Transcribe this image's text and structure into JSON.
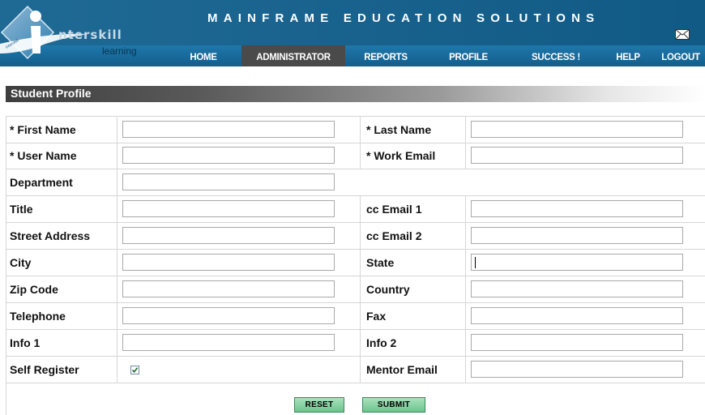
{
  "brand": {
    "name": "nterskill",
    "sub": "learning",
    "badge": "interskill",
    "tagline": "MAINFRAME EDUCATION SOLUTIONS"
  },
  "colors": {
    "header_blue": "#1b6590",
    "nav_blue": "#1f78aa",
    "active_tab": "#4a4a4a",
    "button_green": "#6cc48d"
  },
  "nav": {
    "items": [
      "HOME",
      "ADMINISTRATOR",
      "REPORTS",
      "PROFILE",
      "SUCCESS !",
      "HELP",
      "LOGOUT"
    ],
    "active": "ADMINISTRATOR",
    "mail_icon": "envelope-icon"
  },
  "section": {
    "title": "Student Profile"
  },
  "form": {
    "first_name": {
      "label": "* First Name",
      "value": ""
    },
    "last_name": {
      "label": "* Last Name",
      "value": ""
    },
    "user_name": {
      "label": "* User Name",
      "value": ""
    },
    "work_email": {
      "label": "* Work Email",
      "value": ""
    },
    "department": {
      "label": "Department",
      "value": ""
    },
    "title": {
      "label": "Title",
      "value": ""
    },
    "cc_email_1": {
      "label": "cc Email 1",
      "value": ""
    },
    "street_address": {
      "label": "Street Address",
      "value": ""
    },
    "cc_email_2": {
      "label": "cc Email 2",
      "value": ""
    },
    "city": {
      "label": "City",
      "value": ""
    },
    "state": {
      "label": "State",
      "value": ""
    },
    "zip_code": {
      "label": "Zip Code",
      "value": ""
    },
    "country": {
      "label": "Country",
      "value": ""
    },
    "telephone": {
      "label": "Telephone",
      "value": ""
    },
    "fax": {
      "label": "Fax",
      "value": ""
    },
    "info_1": {
      "label": "Info 1",
      "value": ""
    },
    "info_2": {
      "label": "Info 2",
      "value": ""
    },
    "self_register": {
      "label": "Self Register",
      "checked": true
    },
    "mentor_email": {
      "label": "Mentor Email",
      "value": ""
    }
  },
  "buttons": {
    "reset": "RESET",
    "submit": "SUBMIT"
  }
}
